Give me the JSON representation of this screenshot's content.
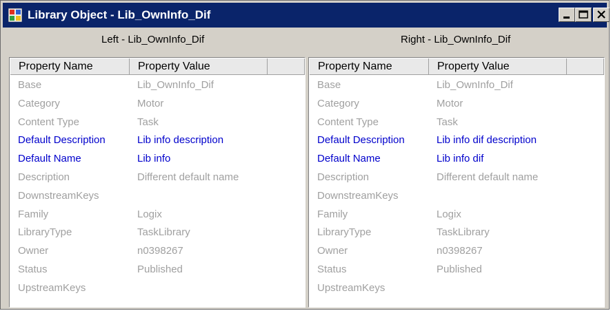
{
  "window": {
    "title": "Library Object - Lib_OwnInfo_Dif",
    "buttons": {
      "minimize": "_",
      "maximize": "□",
      "close": "x"
    }
  },
  "columns": {
    "name": "Property Name",
    "value": "Property Value"
  },
  "left": {
    "title": "Left - Lib_OwnInfo_Dif",
    "rows": [
      {
        "name": "Base",
        "value": "Lib_OwnInfo_Dif"
      },
      {
        "name": "Category",
        "value": "Motor"
      },
      {
        "name": "Content Type",
        "value": "Task"
      },
      {
        "name": "Default Description",
        "value": "Lib info description"
      },
      {
        "name": "Default Name",
        "value": "Lib info"
      },
      {
        "name": "Description",
        "value": "Different default name"
      },
      {
        "name": "DownstreamKeys",
        "value": ""
      },
      {
        "name": "Family",
        "value": "Logix"
      },
      {
        "name": "LibraryType",
        "value": "TaskLibrary"
      },
      {
        "name": "Owner",
        "value": "n0398267"
      },
      {
        "name": "Status",
        "value": "Published"
      },
      {
        "name": "UpstreamKeys",
        "value": ""
      }
    ]
  },
  "right": {
    "title": "Right - Lib_OwnInfo_Dif",
    "rows": [
      {
        "name": "Base",
        "value": "Lib_OwnInfo_Dif"
      },
      {
        "name": "Category",
        "value": "Motor"
      },
      {
        "name": "Content Type",
        "value": "Task"
      },
      {
        "name": "Default Description",
        "value": "Lib info dif description"
      },
      {
        "name": "Default Name",
        "value": "Lib info dif"
      },
      {
        "name": "Description",
        "value": "Different default name"
      },
      {
        "name": "DownstreamKeys",
        "value": ""
      },
      {
        "name": "Family",
        "value": "Logix"
      },
      {
        "name": "LibraryType",
        "value": "TaskLibrary"
      },
      {
        "name": "Owner",
        "value": "n0398267"
      },
      {
        "name": "Status",
        "value": "Published"
      },
      {
        "name": "UpstreamKeys",
        "value": ""
      }
    ]
  },
  "colors": {
    "changed": "#0000cc",
    "unchanged": "#a0a0a0",
    "titlebar": "#0a246a"
  }
}
